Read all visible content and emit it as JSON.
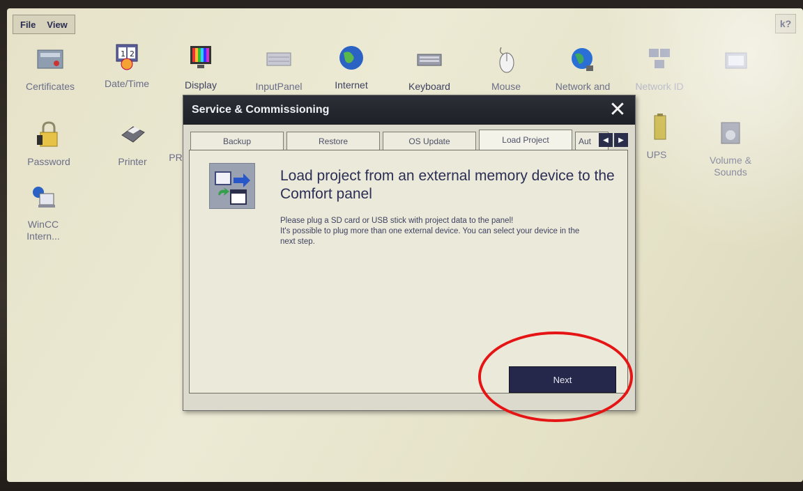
{
  "menubar": {
    "file": "File",
    "view": "View",
    "help": "k?"
  },
  "desktop_icons": [
    {
      "id": "certificates",
      "label": "Certificates",
      "icon": "certificates-icon"
    },
    {
      "id": "datetime",
      "label": "Date/Time",
      "icon": "calendar-clock-icon"
    },
    {
      "id": "display",
      "label": "Display",
      "icon": "display-icon"
    },
    {
      "id": "inputpanel",
      "label": "InputPanel",
      "icon": "keyboard-panel-icon"
    },
    {
      "id": "internet",
      "label": "Internet",
      "icon": "globe-icon"
    },
    {
      "id": "keyboard",
      "label": "Keyboard",
      "icon": "keyboard-icon"
    },
    {
      "id": "mouse",
      "label": "Mouse",
      "icon": "mouse-icon"
    },
    {
      "id": "network",
      "label": "Network and",
      "icon": "network-globe-icon"
    },
    {
      "id": "networkid",
      "label": "Network ID",
      "icon": "network-id-icon"
    },
    {
      "id": "pc",
      "label": "",
      "icon": "monitor-icon"
    },
    {
      "id": "password",
      "label": "Password",
      "icon": "lock-icon"
    },
    {
      "id": "printer",
      "label": "Printer",
      "icon": "printer-icon"
    },
    {
      "id": "pr",
      "label": "PR",
      "icon": ""
    },
    {
      "id": "ups",
      "label": "UPS",
      "icon": "battery-icon"
    },
    {
      "id": "volume",
      "label": "Volume & Sounds",
      "icon": "volume-icon"
    },
    {
      "id": "wincc",
      "label": "WinCC Intern...",
      "icon": "wincc-icon"
    }
  ],
  "dialog": {
    "title": "Service & Commissioning",
    "tabs": [
      "Backup",
      "Restore",
      "OS Update",
      "Load Project",
      "Aut"
    ],
    "active_tab": "Load Project",
    "heading": "Load project from an external memory device to the Comfort panel",
    "description_1": "Please plug a SD card or USB stick with project data to the panel!",
    "description_2": "It's possible to plug more than one external device. You can select your device in the next step.",
    "next_label": "Next"
  },
  "colors": {
    "accent": "#25284a",
    "highlight": "#e51515",
    "titlebar": "#1d2026"
  }
}
